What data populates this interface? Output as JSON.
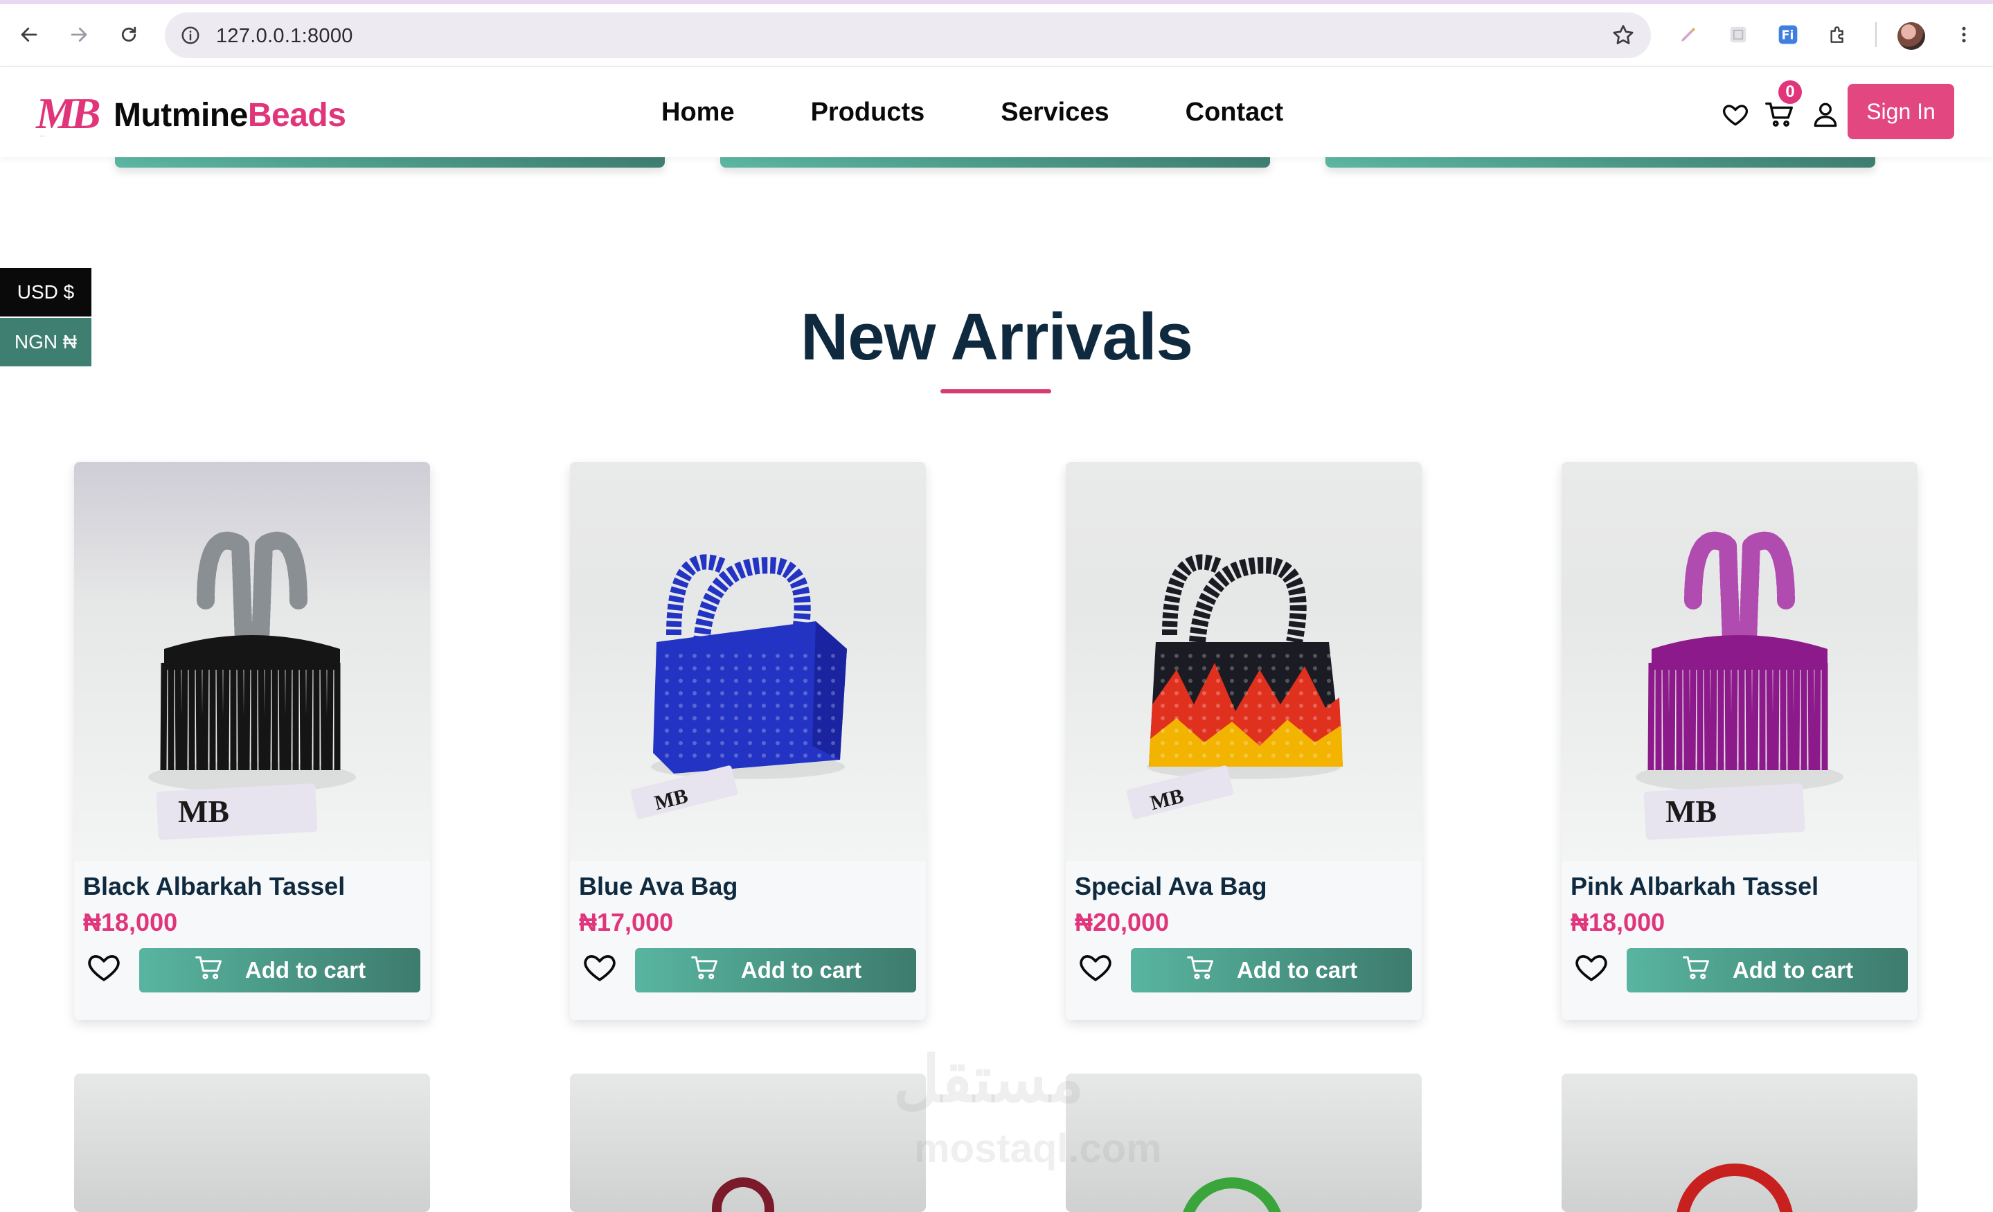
{
  "browser": {
    "url": "127.0.0.1:8000"
  },
  "header": {
    "logo_mark": "MB",
    "logo_word_main": "Mutmine",
    "logo_word_accent": "Beads",
    "nav": [
      {
        "label": "Home"
      },
      {
        "label": "Products"
      },
      {
        "label": "Services"
      },
      {
        "label": "Contact"
      }
    ],
    "cart_count": "0",
    "signin_label": "Sign In"
  },
  "currency": {
    "options": [
      {
        "label": "USD $",
        "selected": true
      },
      {
        "label": "NGN ₦",
        "selected": false
      }
    ]
  },
  "section": {
    "title": "New Arrivals"
  },
  "products": [
    {
      "name": "Black Albarkah Tassel",
      "price": "₦18,000",
      "button": "Add to cart",
      "bag_color": "#151515",
      "handle_color": "#8a8f93",
      "style": "tassel"
    },
    {
      "name": "Blue Ava Bag",
      "price": "₦17,000",
      "button": "Add to cart",
      "bag_color": "#2334c4",
      "handle_color": "#2334c4",
      "style": "beaded"
    },
    {
      "name": "Special Ava Bag",
      "price": "₦20,000",
      "button": "Add to cart",
      "bag_color": "#1b1b24",
      "handle_color": "#1b1b24",
      "style": "flame"
    },
    {
      "name": "Pink Albarkah Tassel",
      "price": "₦18,000",
      "button": "Add to cart",
      "bag_color": "#8c1a8a",
      "handle_color": "#b04bb0",
      "style": "tassel"
    }
  ],
  "next_row_bag_colors": [
    "#cfd1d1",
    "#7a1a2a",
    "#3aa53a",
    "#c8201e"
  ],
  "colors": {
    "brand_pink": "#e0357a",
    "brand_teal": "#3f7f71",
    "heading": "#0f2a3f"
  }
}
